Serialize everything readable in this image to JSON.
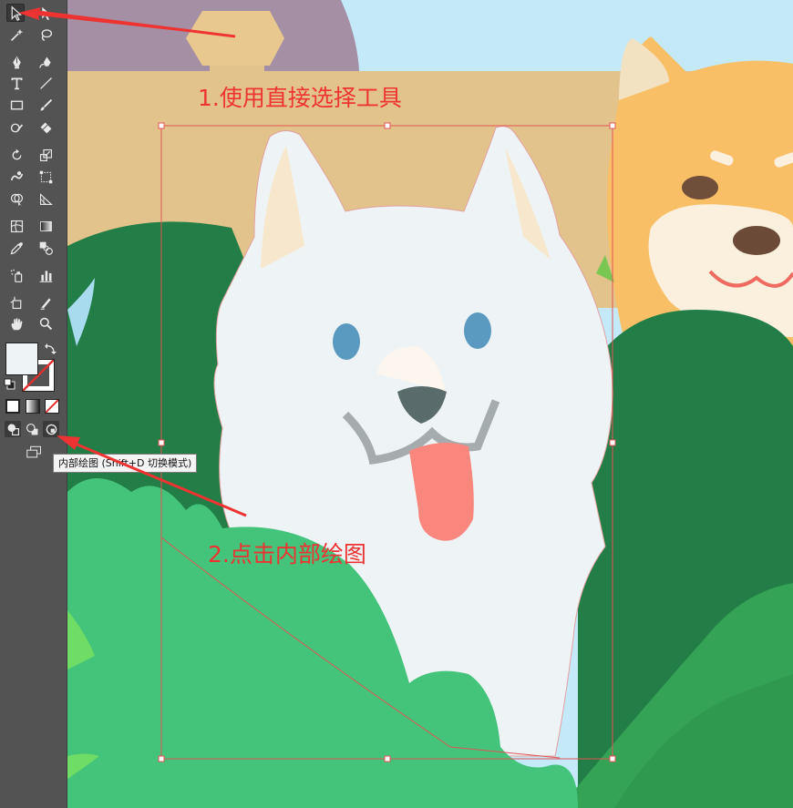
{
  "tooltip": {
    "text": "内部绘图 (Shift+D 切换模式)"
  },
  "annotations": {
    "step1": "1.使用直接选择工具",
    "step2": "2.点击内部绘图"
  },
  "colors": {
    "toolbar_bg": "#535353",
    "annotation": "#ee3333",
    "selection": "#e25555",
    "sky": "#c4e9f8",
    "fence": "#e2c38c",
    "bush_dark": "#227d47",
    "bush_light": "#44c47a",
    "dog_white": "#eef4f6"
  },
  "tools": [
    {
      "name": "selection-tool-icon",
      "interactable": true
    },
    {
      "name": "direct-selection-tool-icon",
      "interactable": true,
      "selected": true
    },
    {
      "name": "magic-wand-tool-icon",
      "interactable": true
    },
    {
      "name": "lasso-tool-icon",
      "interactable": true
    },
    {
      "name": "pen-tool-icon",
      "interactable": true
    },
    {
      "name": "curvature-tool-icon",
      "interactable": true
    },
    {
      "name": "type-tool-icon",
      "interactable": true
    },
    {
      "name": "line-tool-icon",
      "interactable": true
    },
    {
      "name": "rectangle-tool-icon",
      "interactable": true
    },
    {
      "name": "paintbrush-tool-icon",
      "interactable": true
    },
    {
      "name": "shaper-tool-icon",
      "interactable": true
    },
    {
      "name": "eraser-tool-icon",
      "interactable": true
    },
    {
      "name": "rotate-tool-icon",
      "interactable": true
    },
    {
      "name": "scale-tool-icon",
      "interactable": true
    },
    {
      "name": "warp-tool-icon",
      "interactable": true
    },
    {
      "name": "free-transform-tool-icon",
      "interactable": true
    },
    {
      "name": "shape-builder-tool-icon",
      "interactable": true
    },
    {
      "name": "perspective-grid-tool-icon",
      "interactable": true
    },
    {
      "name": "mesh-tool-icon",
      "interactable": true
    },
    {
      "name": "gradient-tool-icon",
      "interactable": true
    },
    {
      "name": "eyedropper-tool-icon",
      "interactable": true
    },
    {
      "name": "blend-tool-icon",
      "interactable": true
    },
    {
      "name": "symbol-sprayer-tool-icon",
      "interactable": true
    },
    {
      "name": "column-graph-tool-icon",
      "interactable": true
    },
    {
      "name": "artboard-tool-icon",
      "interactable": true
    },
    {
      "name": "slice-tool-icon",
      "interactable": true
    },
    {
      "name": "hand-tool-icon",
      "interactable": true
    },
    {
      "name": "zoom-tool-icon",
      "interactable": true
    }
  ]
}
